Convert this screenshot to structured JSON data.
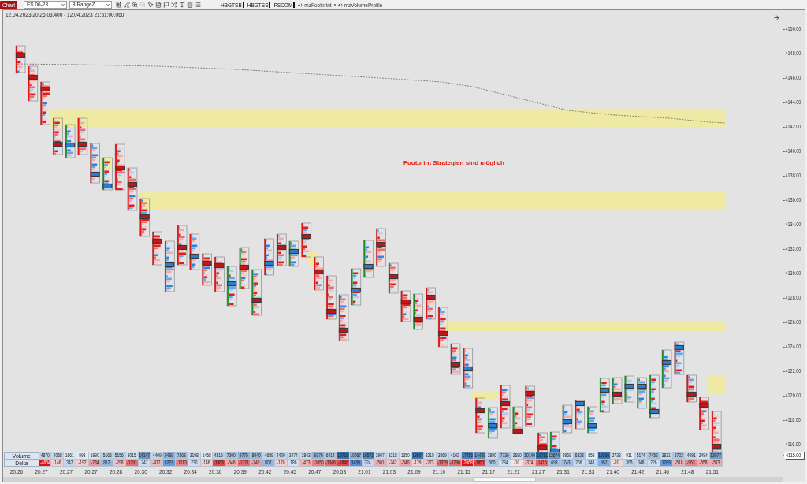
{
  "toolbar": {
    "tab": {
      "label": "Chart",
      "selected": true
    },
    "instrument": {
      "value": "ES 06-23"
    },
    "bar_type": {
      "value": "8 RangeZ"
    },
    "tools": [
      {
        "disabled": false
      },
      {
        "disabled": false
      },
      {
        "disabled": false
      },
      {
        "disabled": true
      },
      {
        "disabled": false
      },
      {
        "disabled": false
      },
      {
        "disabled": false
      },
      {
        "disabled": false
      },
      {
        "disabled": false
      },
      {
        "disabled": false
      },
      {
        "disabled": false
      }
    ],
    "indicators": [
      {
        "label": "HBGTSB"
      },
      {
        "label": "HBGTSS"
      },
      {
        "label": "PSCOM"
      }
    ],
    "strategies": [
      {
        "label": "mzFootprint"
      },
      {
        "label": "mzVolumeProfile"
      }
    ]
  },
  "chart": {
    "title": "12.04.2023 20:26:03.400 - 12.04.2023 21:51:00.060",
    "annotation": "Footprint Strategien sind möglich",
    "price_axis": {
      "ticks": [
        "4150.00",
        "4148.00",
        "4146.00",
        "4144.00",
        "4142.00",
        "4140.00",
        "4138.00",
        "4136.00",
        "4134.00",
        "4132.00",
        "4130.00",
        "4128.00",
        "4126.00",
        "4124.00",
        "4122.00",
        "4120.00",
        "4118.00",
        "4116.00"
      ],
      "last_price": "4115.00"
    },
    "volume_row": {
      "label": "Volume",
      "cells": [
        "4870",
        "4058",
        "1661",
        "998",
        "1990",
        "5166",
        "5156",
        "3015",
        "14147",
        "4409",
        "9489",
        "7263",
        "3198",
        "1458",
        "4815",
        "7200",
        "9775",
        "8940",
        "4689",
        "4420",
        "3474",
        "3843",
        "9376",
        "6414",
        "19718",
        "10067",
        "16572",
        "3907",
        "3218",
        "1350",
        "18607",
        "3215",
        "3869",
        "4102",
        "17456",
        "14439",
        "3890",
        "7736",
        "3690",
        "10140",
        "19781",
        "13674",
        "2969",
        "6328",
        "853",
        "19366",
        "2733",
        "911",
        "5174",
        "7452",
        "3831",
        "6722",
        "4091",
        "2494",
        "13077"
      ]
    },
    "delta_row": {
      "label": "Delta",
      "cells": [
        "-4654",
        "-146",
        "347",
        "-192",
        "-784",
        "812",
        "-298",
        "-1291",
        "247",
        "-417",
        "1223",
        "-1013",
        "230",
        "-146",
        "-1863",
        "-546",
        "-1321",
        "-742",
        "807",
        "-170",
        "186",
        "-473",
        "-1050",
        "-1346",
        "-1846",
        "1439",
        "324",
        "-501",
        "-242",
        "-640",
        "-129",
        "-273",
        "-1379",
        "-1290",
        "-2668",
        "-1857",
        "560",
        "234",
        "-10",
        "-374",
        "-1415",
        "698",
        "743",
        "266",
        "341",
        "957",
        "-91",
        "395",
        "348",
        "226",
        "1289",
        "-518",
        "-963",
        "-558",
        "-573"
      ]
    },
    "time_axis": [
      "20:26",
      "20:27",
      "20:27",
      "20:27",
      "20:28",
      "20:30",
      "20:32",
      "20:34",
      "20:36",
      "20:39",
      "20:42",
      "20:45",
      "20:47",
      "20:53",
      "21:01",
      "21:03",
      "21:09",
      "21:10",
      "21:15",
      "21:17",
      "21:21",
      "21:27",
      "21:31",
      "21:33",
      "21:40",
      "21:42",
      "21:46",
      "21:48",
      "21:51"
    ]
  }
}
